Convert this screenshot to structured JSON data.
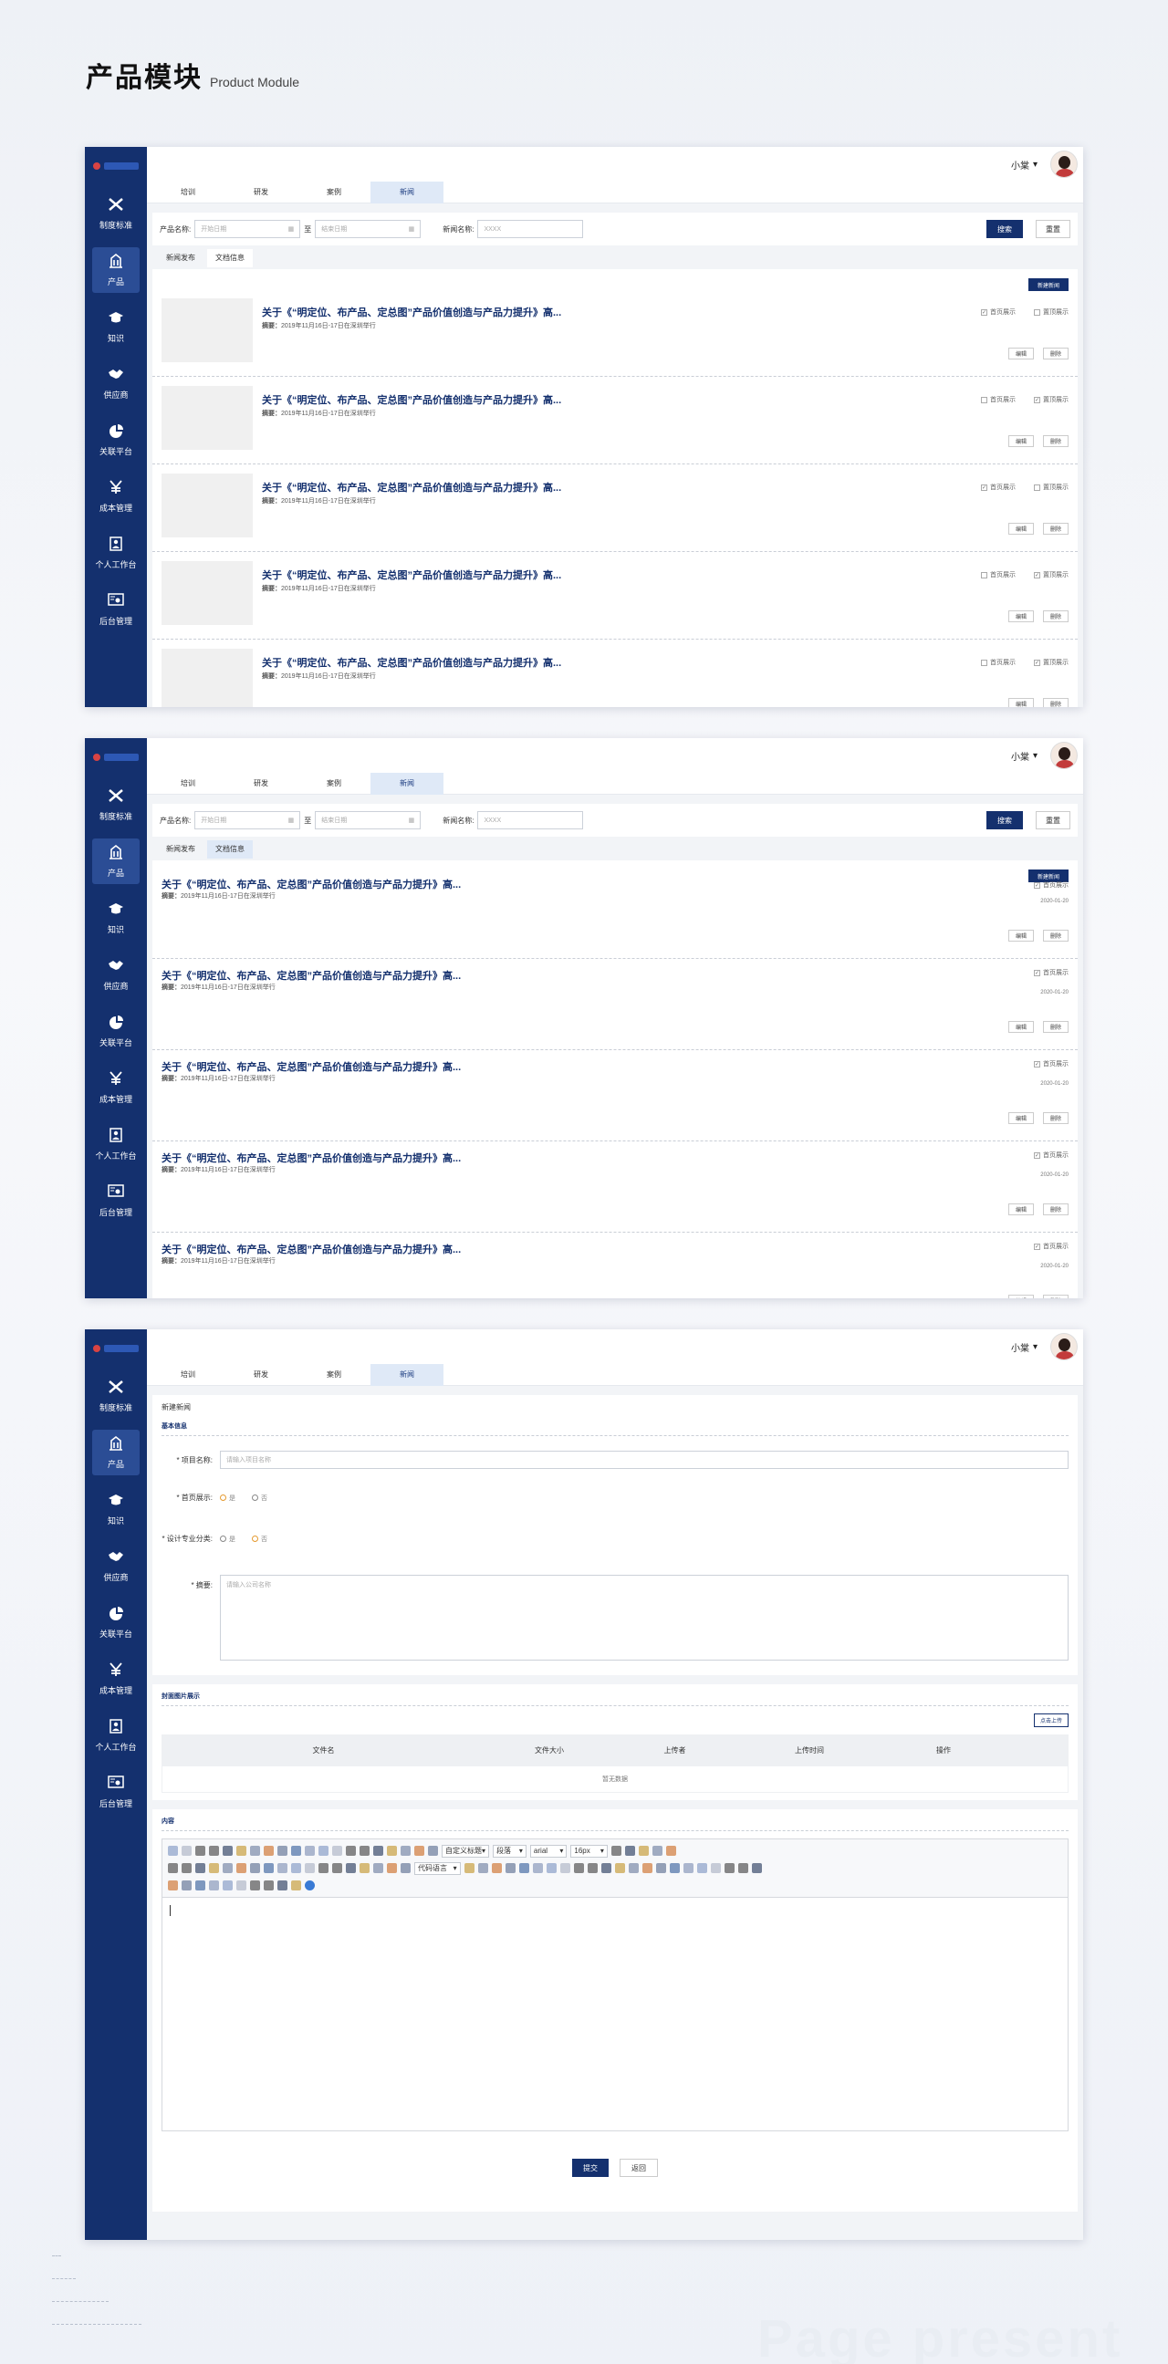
{
  "title": {
    "zh": "产品模块",
    "en": "Product Module"
  },
  "user": {
    "name": "小棠"
  },
  "sidebar": {
    "items": [
      {
        "label": "制度标准",
        "icon": "tools-icon"
      },
      {
        "label": "产品",
        "icon": "building-icon"
      },
      {
        "label": "知识",
        "icon": "graduation-cap-icon"
      },
      {
        "label": "供应商",
        "icon": "handshake-icon"
      },
      {
        "label": "关联平台",
        "icon": "pie-chart-icon"
      },
      {
        "label": "成本管理",
        "icon": "yen-icon"
      },
      {
        "label": "个人工作台",
        "icon": "person-card-icon"
      },
      {
        "label": "后台管理",
        "icon": "admin-screen-icon"
      }
    ]
  },
  "tabs": [
    "培训",
    "研发",
    "案例",
    "新闻"
  ],
  "filter": {
    "product_label": "产品名称:",
    "start_placeholder": "开始日期",
    "to": "至",
    "end_placeholder": "结束日期",
    "news_label": "新闻名称:",
    "news_placeholder": "XXXX",
    "search": "搜索",
    "reset": "重置"
  },
  "subtabs": [
    "新闻发布",
    "文档信息"
  ],
  "new_news": "新建新闻",
  "news_title": "关于《“明定位、布产品、定总图”产品价值创造与产品力提升》高...",
  "summary_label": "摘要：",
  "summary": "2019年11月16日-17日在深圳举行",
  "check_home": "首页展示",
  "check_top": "置顶展示",
  "edit": "编辑",
  "delete": "删除",
  "date": "2020-01-20",
  "form": {
    "heading": "新建新闻",
    "basic": "基本信息",
    "project_label": "* 项目名称:",
    "project_placeholder": "请输入项目名称",
    "home_label": "* 首页展示:",
    "design_label": "* 设计专业分类:",
    "opt_yes": "是",
    "opt_no": "否",
    "abstract_label": "* 摘要:",
    "abstract_placeholder": "请输入公司名称",
    "cover": "封面图片展示",
    "upload": "点击上传",
    "cols": [
      "文件名",
      "文件大小",
      "上传者",
      "上传时间",
      "操作"
    ],
    "empty": "暂无数据",
    "content": "内容",
    "submit": "提交",
    "back": "返回"
  },
  "toolbar": {
    "custom_title": "自定义标题",
    "paragraph": "段落",
    "font": "arial",
    "size": "16px",
    "code_lang": "代码语言"
  },
  "watermark": "Page present",
  "colors": {
    "brand": "#14306e",
    "accent": "#e59a2f"
  }
}
